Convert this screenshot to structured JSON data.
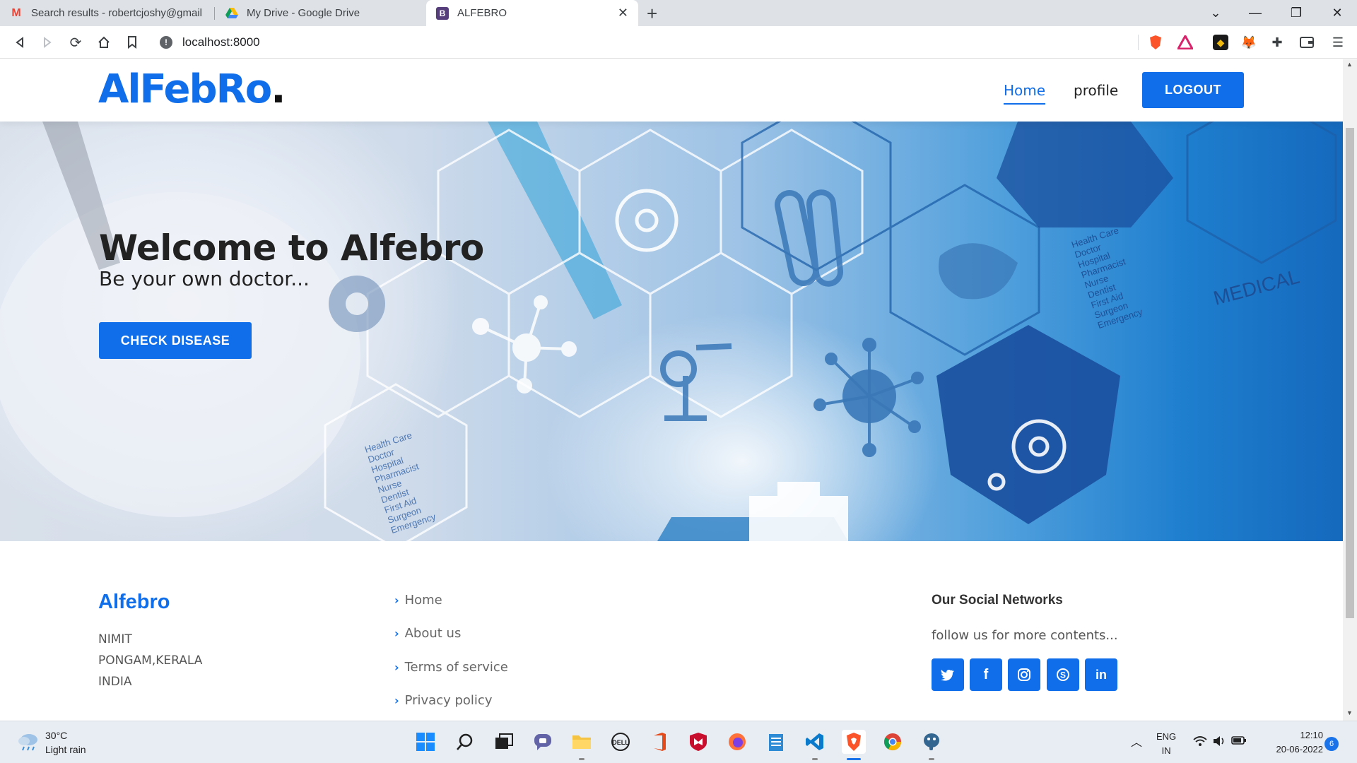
{
  "browser": {
    "tabs": [
      {
        "title": "Search results - robertcjoshy@gmail.com",
        "favicon": "gmail-icon"
      },
      {
        "title": "My Drive - Google Drive",
        "favicon": "google-drive-icon"
      },
      {
        "title": "ALFEBRO",
        "favicon": "bootstrap-b-icon"
      }
    ],
    "url": "localhost:8000",
    "new_tab_symbol": "+",
    "close_symbol": "✕"
  },
  "site": {
    "logo_text": "AlFebRo",
    "logo_dot": ".",
    "nav": {
      "home": "Home",
      "profile": "profile",
      "logout": "LOGOUT"
    },
    "hero": {
      "title": "Welcome to Alfebro",
      "subtitle": "Be your own doctor...",
      "button": "CHECK DISEASE",
      "image_text": {
        "medical": "MEDICAL",
        "list": [
          "Health Care",
          "Doctor",
          "Hospital",
          "Pharmacist",
          "Nurse",
          "Dentist",
          "First Aid",
          "Surgeon",
          "Emergency"
        ]
      }
    },
    "footer": {
      "brand": "Alfebro",
      "address": [
        "NIMIT",
        "PONGAM,KERALA",
        "INDIA"
      ],
      "links": [
        "Home",
        "About us",
        "Terms of service",
        "Privacy policy"
      ],
      "social_title": "Our Social Networks",
      "social_text": "follow us for more contents...",
      "social_icons": [
        "twitter-icon",
        "facebook-icon",
        "instagram-icon",
        "skype-icon",
        "linkedin-icon"
      ]
    }
  },
  "taskbar": {
    "weather": {
      "temp": "30°C",
      "desc": "Light rain"
    },
    "apps": [
      "windows-start-icon",
      "search-icon",
      "task-view-icon",
      "teams-chat-icon",
      "file-explorer-icon",
      "dell-icon",
      "office-icon",
      "mcafee-icon",
      "firefox-icon",
      "notepad-icon",
      "vscode-icon",
      "brave-icon",
      "chrome-icon",
      "postgres-icon"
    ],
    "lang": [
      "ENG",
      "IN"
    ],
    "time": "12:10",
    "date": "20-06-2022",
    "notifications": "6"
  },
  "colors": {
    "accent": "#106eea",
    "chrome_bg": "#dee1e6",
    "taskbar_bg": "#e8edf3"
  }
}
